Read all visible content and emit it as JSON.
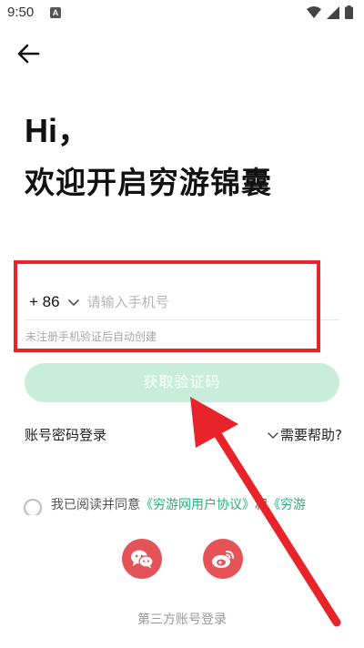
{
  "status_bar": {
    "time": "9:50",
    "notification_letter": "A"
  },
  "header": {
    "back_icon": "arrow-left-icon"
  },
  "greeting": {
    "line1": "Hi，",
    "line2": "欢迎开启穷游锦囊"
  },
  "phone_form": {
    "country_code": "+ 86",
    "phone_placeholder": "请输入手机号",
    "phone_value": "",
    "hint": "未注册手机验证后自动创建"
  },
  "get_code_button": "获取验证码",
  "links": {
    "password_login": "账号密码登录",
    "help": "需要帮助?"
  },
  "agreement": {
    "prefix": "我已阅读并同意",
    "terms": "《穷游网用户协议》",
    "and": "和",
    "privacy": "《穷游"
  },
  "social_login": {
    "label": "第三方账号登录",
    "providers": [
      "wechat-icon",
      "weibo-icon"
    ]
  },
  "colors": {
    "accent": "#22b47a",
    "button_disabled": "#c8eedb",
    "social": "#e35357",
    "annotation_red": "#e8242a"
  }
}
